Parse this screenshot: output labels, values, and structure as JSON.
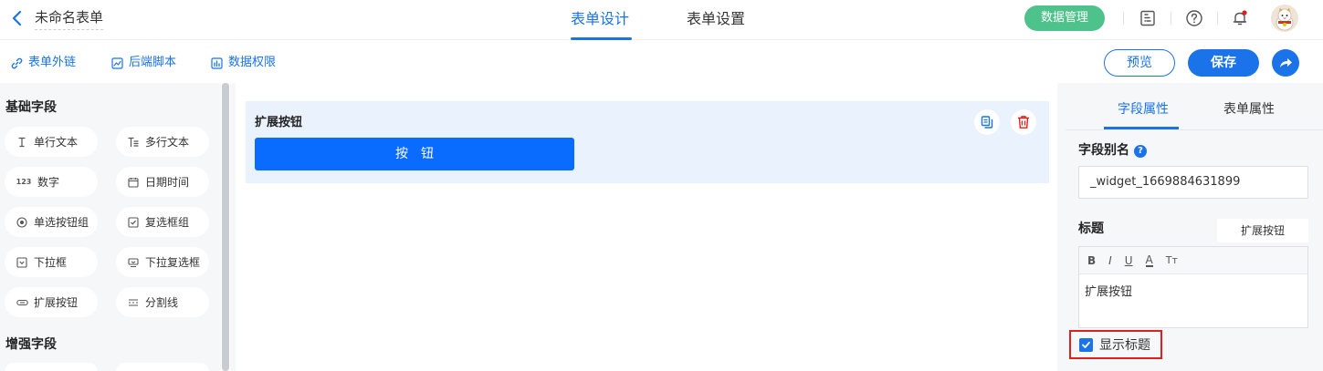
{
  "header": {
    "form_title": "未命名表单",
    "tabs": [
      {
        "label": "表单设计",
        "active": true
      },
      {
        "label": "表单设置",
        "active": false
      }
    ],
    "data_mgmt_label": "数据管理",
    "accent": "#1a73e8",
    "green": "#4ec28b",
    "icons": [
      "back-arrow-icon",
      "form-icon",
      "help-icon",
      "bell-icon",
      "avatar"
    ]
  },
  "toolbar": {
    "links": [
      {
        "label": "表单外链",
        "icon": "link-icon"
      },
      {
        "label": "后端脚本",
        "icon": "script-icon"
      },
      {
        "label": "数据权限",
        "icon": "permission-icon"
      }
    ],
    "preview_label": "预览",
    "save_label": "保存"
  },
  "left_panel": {
    "basic_title": "基础字段",
    "enhanced_title": "增强字段",
    "fields": [
      {
        "label": "单行文本",
        "icon": "text-cursor-icon"
      },
      {
        "label": "多行文本",
        "icon": "multiline-text-icon"
      },
      {
        "label": "数字",
        "icon": "number-icon",
        "glyph": "123"
      },
      {
        "label": "日期时间",
        "icon": "calendar-icon"
      },
      {
        "label": "单选按钮组",
        "icon": "radio-icon"
      },
      {
        "label": "复选框组",
        "icon": "checkbox-icon"
      },
      {
        "label": "下拉框",
        "icon": "dropdown-icon"
      },
      {
        "label": "下拉复选框",
        "icon": "dropdown-multi-icon"
      },
      {
        "label": "扩展按钮",
        "icon": "button-icon"
      },
      {
        "label": "分割线",
        "icon": "divider-icon"
      }
    ]
  },
  "canvas": {
    "widget_label": "扩展按钮",
    "button_text": "按钮"
  },
  "right_panel": {
    "tabs": [
      {
        "label": "字段属性",
        "active": true
      },
      {
        "label": "表单属性",
        "active": false
      }
    ],
    "alias_label": "字段别名",
    "alias_value": "_widget_1669884631899",
    "title_label": "标题",
    "title_value": "扩展按钮",
    "editor_tools": [
      "B",
      "I",
      "U",
      "A",
      "Tт"
    ],
    "editor_content": "扩展按钮",
    "show_title_label": "显示标题",
    "show_title_checked": true
  }
}
